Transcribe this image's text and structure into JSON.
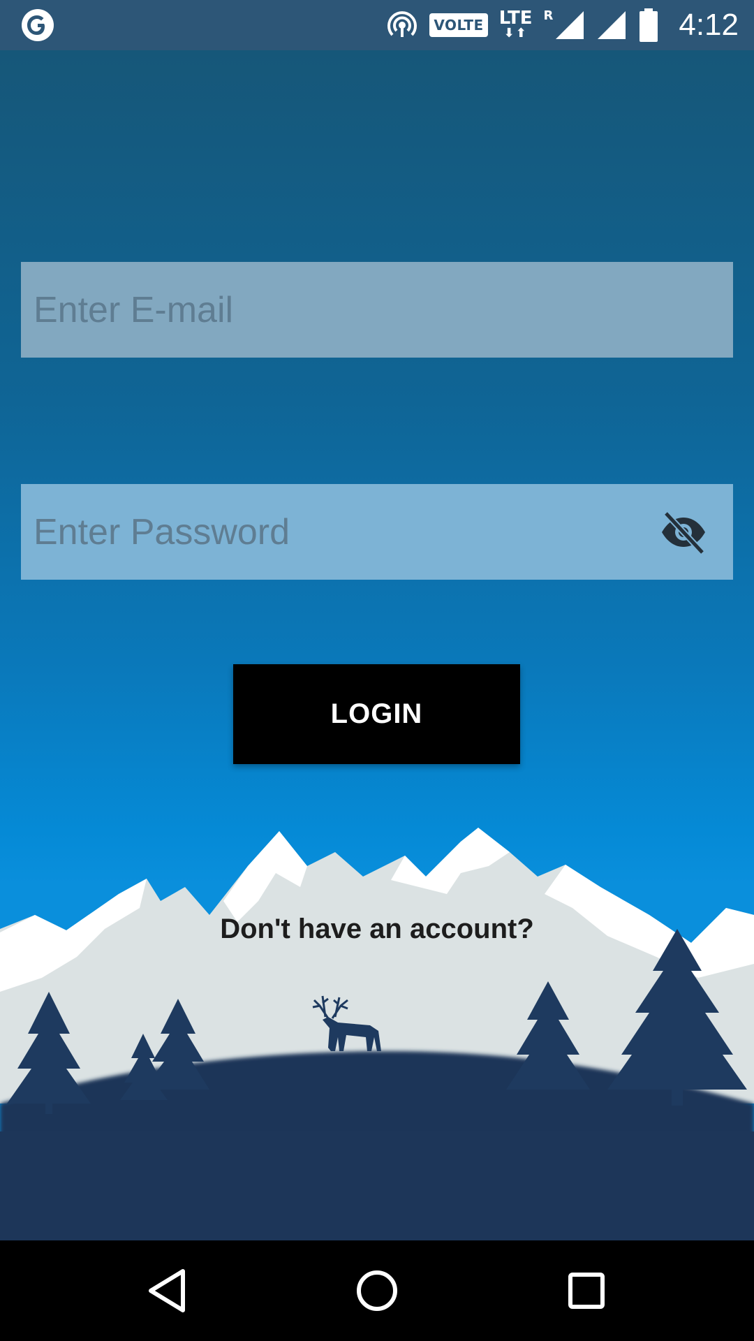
{
  "status_bar": {
    "app_icon": "google-g-icon",
    "icons": [
      "hotspot-icon",
      "volte-icon",
      "lte-data-icon",
      "roaming-signal-icon",
      "signal-icon",
      "battery-icon"
    ],
    "volte_label": "VOLTE",
    "lte_label": "LTE",
    "lte_arrows": "⬇⬆",
    "roaming_label": "R",
    "time": "4:12"
  },
  "form": {
    "email_placeholder": "Enter E-mail",
    "password_placeholder": "Enter Password",
    "password_visibility_icon": "eye-off-icon",
    "login_label": "LOGIN",
    "signup_prompt": "Don't have an account?"
  },
  "nav_bar": {
    "back_icon": "back-triangle-icon",
    "home_icon": "home-circle-icon",
    "recents_icon": "recents-square-icon"
  },
  "colors": {
    "status_bar": "#2d5677",
    "email_field": "#82a8c0",
    "password_field": "#7db3d5",
    "button": "#000000",
    "ground": "#1d3659",
    "snow": "#d6dfe0"
  }
}
